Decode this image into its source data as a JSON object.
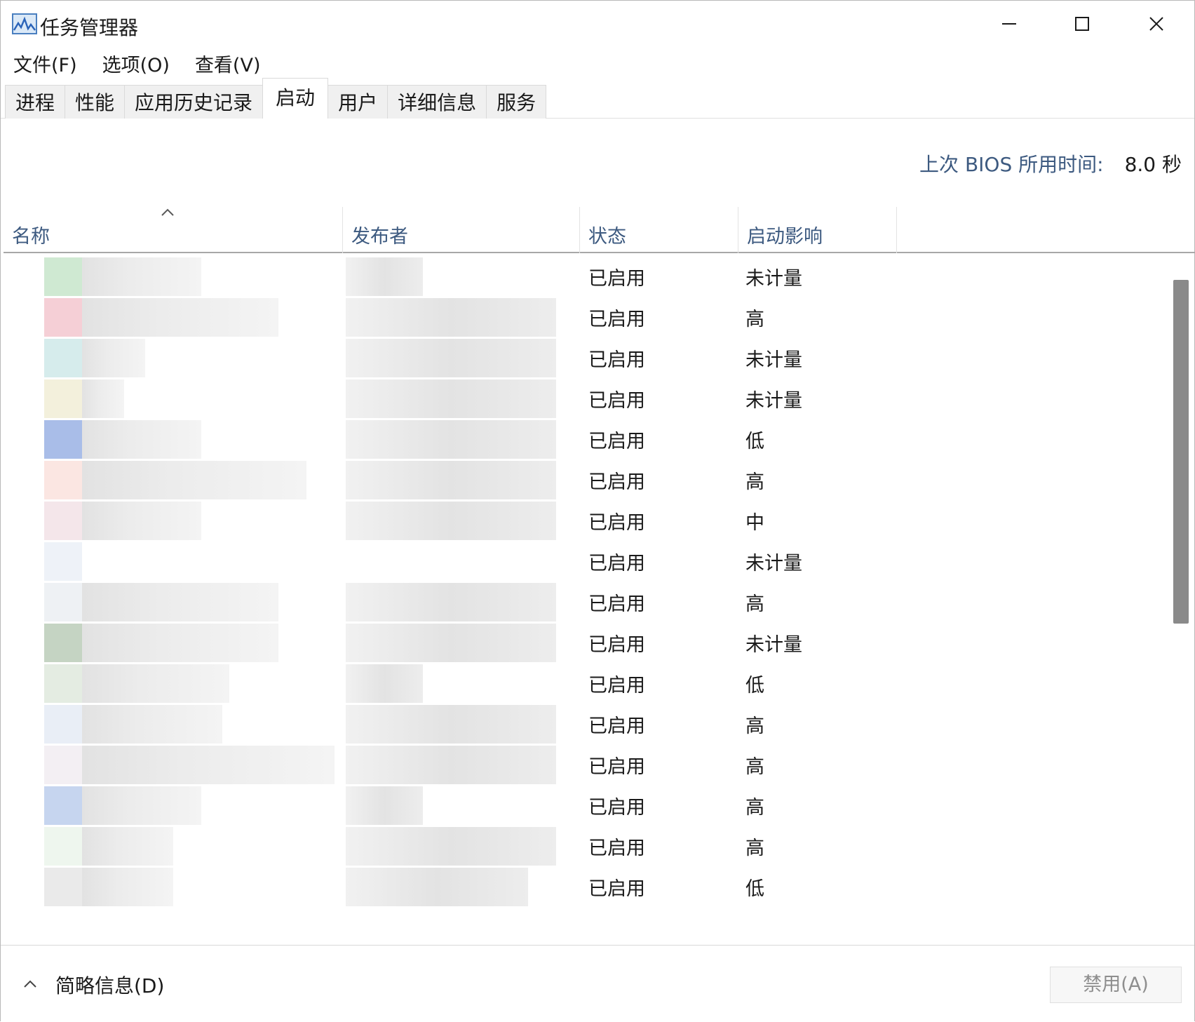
{
  "window": {
    "title": "任务管理器"
  },
  "menu": [
    "文件(F)",
    "选项(O)",
    "查看(V)"
  ],
  "tabs": [
    "进程",
    "性能",
    "应用历史记录",
    "启动",
    "用户",
    "详细信息",
    "服务"
  ],
  "active_tab": "启动",
  "bios": {
    "label": "上次 BIOS 所用时间:",
    "value": "8.0 秒"
  },
  "columns": {
    "name": "名称",
    "publisher": "发布者",
    "status": "状态",
    "impact": "启动影响"
  },
  "rows": [
    {
      "status": "已启用",
      "impact": "未计量"
    },
    {
      "status": "已启用",
      "impact": "高"
    },
    {
      "status": "已启用",
      "impact": "未计量"
    },
    {
      "status": "已启用",
      "impact": "未计量"
    },
    {
      "status": "已启用",
      "impact": "低"
    },
    {
      "status": "已启用",
      "impact": "高"
    },
    {
      "status": "已启用",
      "impact": "中"
    },
    {
      "status": "已启用",
      "impact": "未计量"
    },
    {
      "status": "已启用",
      "impact": "高"
    },
    {
      "status": "已启用",
      "impact": "未计量"
    },
    {
      "status": "已启用",
      "impact": "低"
    },
    {
      "status": "已启用",
      "impact": "高"
    },
    {
      "status": "已启用",
      "impact": "高"
    },
    {
      "status": "已启用",
      "impact": "高"
    },
    {
      "status": "已启用",
      "impact": "高"
    },
    {
      "status": "已启用",
      "impact": "低"
    }
  ],
  "footer": {
    "details_label": "简略信息(D)",
    "disable_label": "禁用(A)"
  },
  "colors": {
    "accent_text": "#3d5a80",
    "scroll_thumb": "#8a8a8a"
  }
}
